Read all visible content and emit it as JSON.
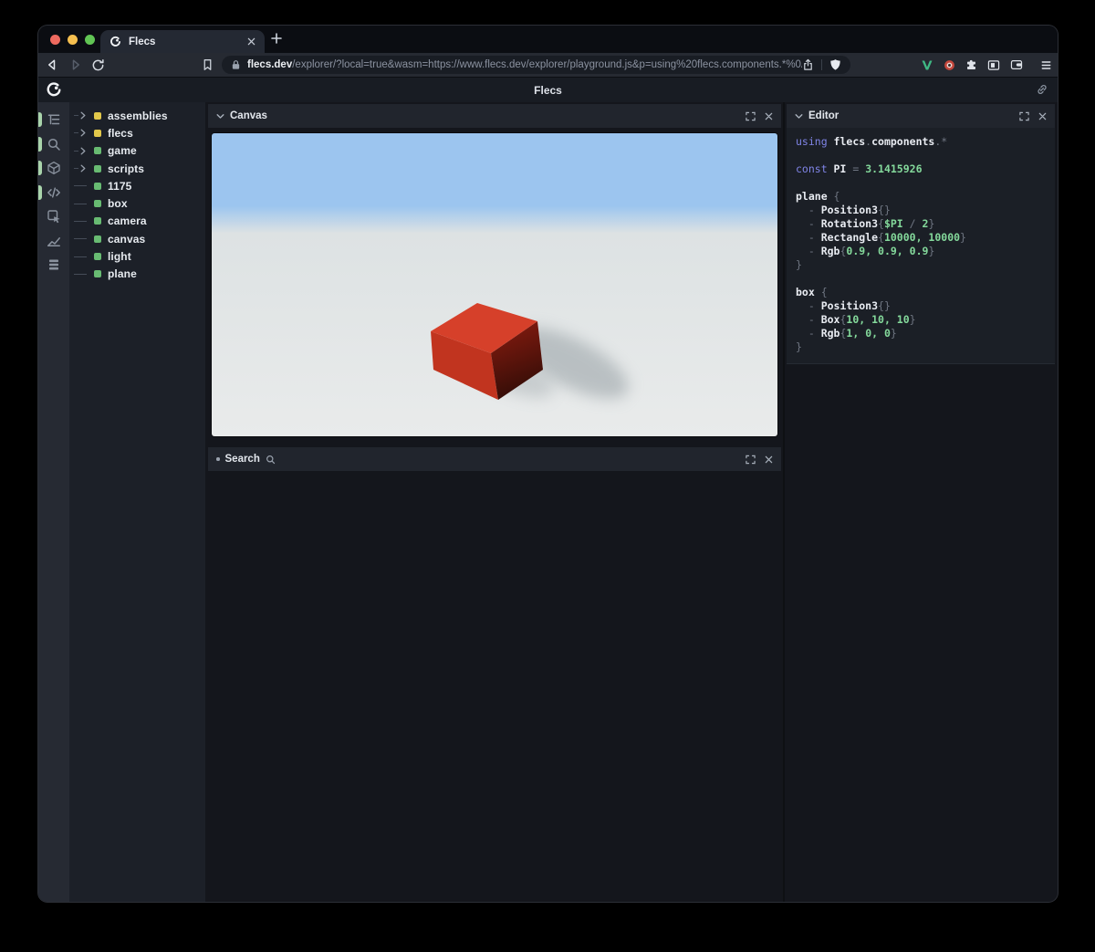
{
  "browser": {
    "tab_title": "Flecs",
    "url_host": "flecs.dev",
    "url_path": "/explorer/?local=true&wasm=https://www.flecs.dev/explorer/playground.js&p=using%20flecs.components.*%0A...",
    "traffic_lights": {
      "close": "#ee6a5f",
      "minimize": "#f5bf4f",
      "zoom": "#61c554"
    },
    "extensions": [
      "v-logo-icon",
      "record-icon",
      "puzzle-icon",
      "sidebar-toggle-icon",
      "wallet-icon",
      "menu-icon"
    ],
    "v_logo_color": "#3fb984"
  },
  "app": {
    "title": "Flecs"
  },
  "explorer": {
    "nav_icons": [
      {
        "name": "tree-icon",
        "active": true
      },
      {
        "name": "search-icon",
        "active": true
      },
      {
        "name": "cube-icon",
        "active": true
      },
      {
        "name": "code-icon",
        "active": true
      },
      {
        "name": "inspect-icon",
        "active": false
      },
      {
        "name": "chart-icon",
        "active": false
      },
      {
        "name": "stack-icon",
        "active": false
      }
    ],
    "active_indicator_color": "#a9d4ab",
    "tree": [
      {
        "label": "assemblies",
        "dot": "#e2c84b",
        "expandable": true
      },
      {
        "label": "flecs",
        "dot": "#e2c84b",
        "expandable": true
      },
      {
        "label": "game",
        "dot": "#68bb72",
        "expandable": true
      },
      {
        "label": "scripts",
        "dot": "#68bb72",
        "expandable": true
      },
      {
        "label": "1175",
        "dot": "#68bb72",
        "expandable": false
      },
      {
        "label": "box",
        "dot": "#68bb72",
        "expandable": false
      },
      {
        "label": "camera",
        "dot": "#68bb72",
        "expandable": false
      },
      {
        "label": "canvas",
        "dot": "#68bb72",
        "expandable": false
      },
      {
        "label": "light",
        "dot": "#68bb72",
        "expandable": false
      },
      {
        "label": "plane",
        "dot": "#68bb72",
        "expandable": false
      }
    ],
    "panels": {
      "canvas_title": "Canvas",
      "search_title": "Search",
      "editor_title": "Editor"
    },
    "scene": {
      "sky": "#9cc5ef",
      "horizon": "#dde2e3",
      "ground": "#e9ebeb",
      "box_top": "#d6402a",
      "box_front": "#c1341f",
      "box_side_light": "#8c1c10",
      "box_side_dark": "#340d07",
      "shadow": "#8e989d"
    },
    "code": [
      [
        [
          "k",
          "using "
        ],
        [
          "i",
          "flecs"
        ],
        [
          "p",
          "."
        ],
        [
          "i",
          "components"
        ],
        [
          "p",
          ".*"
        ]
      ],
      [],
      [
        [
          "k",
          "const "
        ],
        [
          "i",
          "PI"
        ],
        [
          "p",
          " = "
        ],
        [
          "n",
          "3.1415926"
        ]
      ],
      [],
      [
        [
          "i",
          "plane"
        ],
        [
          "p",
          " {"
        ]
      ],
      [
        [
          "p",
          "  - "
        ],
        [
          "i",
          "Position3"
        ],
        [
          "p",
          "{}"
        ]
      ],
      [
        [
          "p",
          "  - "
        ],
        [
          "i",
          "Rotation3"
        ],
        [
          "p",
          "{"
        ],
        [
          "v",
          "$PI"
        ],
        [
          "p",
          " / "
        ],
        [
          "n",
          "2"
        ],
        [
          "p",
          "}"
        ]
      ],
      [
        [
          "p",
          "  - "
        ],
        [
          "i",
          "Rectangle"
        ],
        [
          "p",
          "{"
        ],
        [
          "n",
          "10000, 10000"
        ],
        [
          "p",
          "}"
        ]
      ],
      [
        [
          "p",
          "  - "
        ],
        [
          "i",
          "Rgb"
        ],
        [
          "p",
          "{"
        ],
        [
          "n",
          "0.9, 0.9, 0.9"
        ],
        [
          "p",
          "}"
        ]
      ],
      [
        [
          "p",
          "}"
        ]
      ],
      [],
      [
        [
          "i",
          "box"
        ],
        [
          "p",
          " {"
        ]
      ],
      [
        [
          "p",
          "  - "
        ],
        [
          "i",
          "Position3"
        ],
        [
          "p",
          "{}"
        ]
      ],
      [
        [
          "p",
          "  - "
        ],
        [
          "i",
          "Box"
        ],
        [
          "p",
          "{"
        ],
        [
          "n",
          "10, 10, 10"
        ],
        [
          "p",
          "}"
        ]
      ],
      [
        [
          "p",
          "  - "
        ],
        [
          "i",
          "Rgb"
        ],
        [
          "p",
          "{"
        ],
        [
          "n",
          "1, 0, 0"
        ],
        [
          "p",
          "}"
        ]
      ],
      [
        [
          "p",
          "}"
        ]
      ]
    ]
  }
}
